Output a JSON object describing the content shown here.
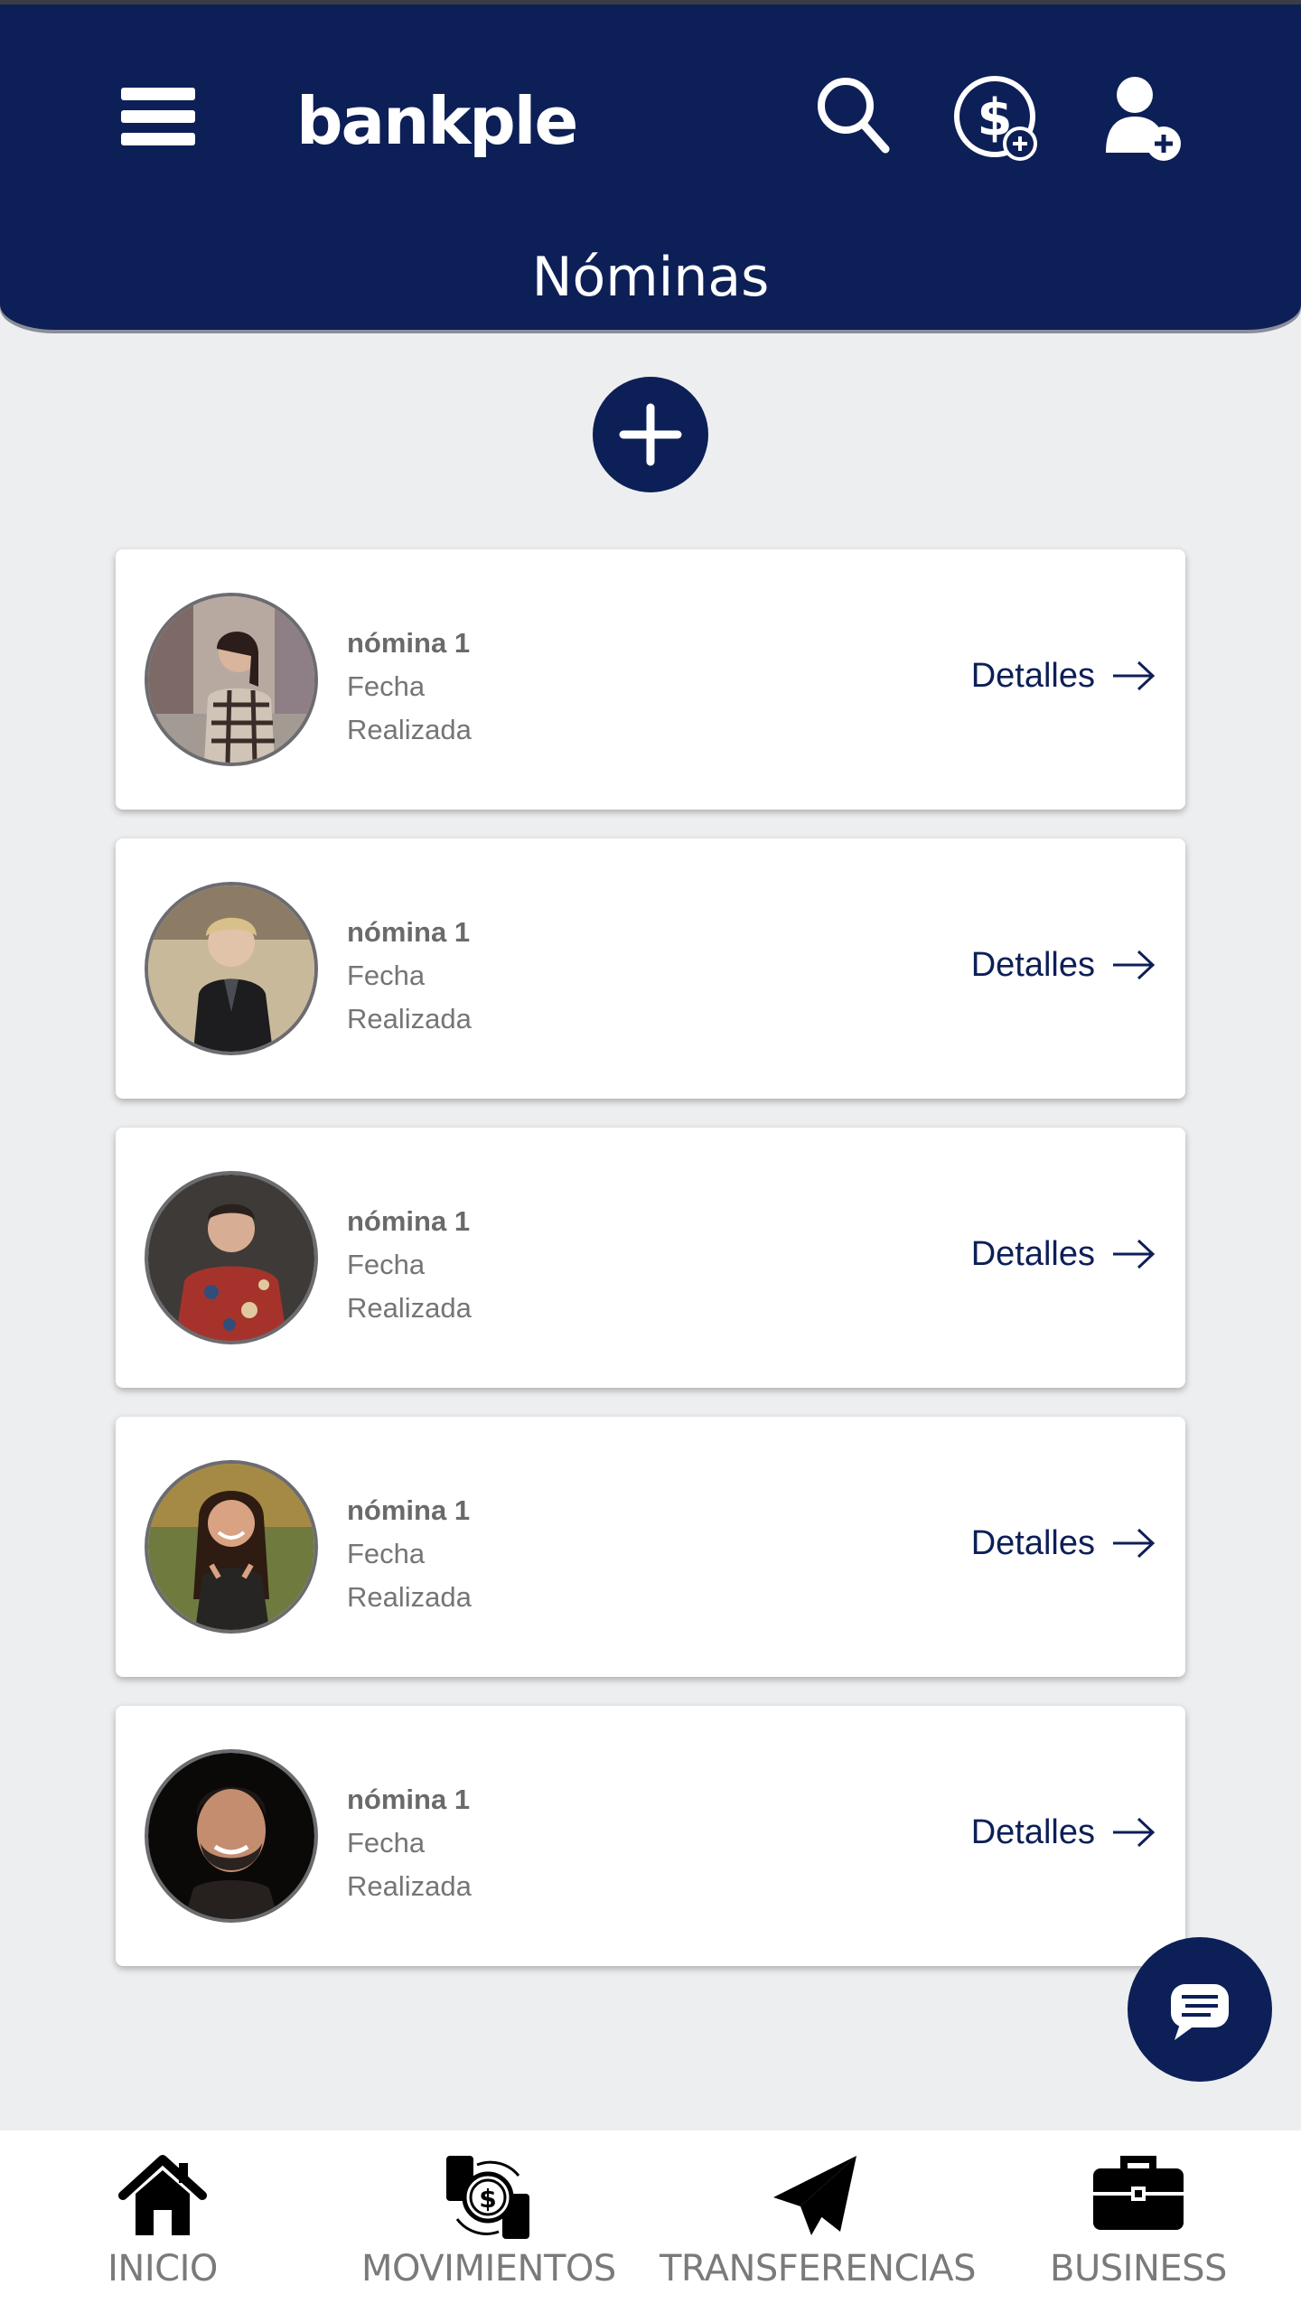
{
  "app": {
    "logo_text": "bankple",
    "page_title": "Nóminas"
  },
  "header": {
    "icons": [
      "menu-icon",
      "search-icon",
      "dollar-add-icon",
      "user-add-icon"
    ]
  },
  "payrolls": [
    {
      "title": "nómina 1",
      "date": "Fecha",
      "status": "Realizada",
      "details_label": "Detalles"
    },
    {
      "title": "nómina 1",
      "date": "Fecha",
      "status": "Realizada",
      "details_label": "Detalles"
    },
    {
      "title": "nómina 1",
      "date": "Fecha",
      "status": "Realizada",
      "details_label": "Detalles"
    },
    {
      "title": "nómina 1",
      "date": "Fecha",
      "status": "Realizada",
      "details_label": "Detalles"
    },
    {
      "title": "nómina 1",
      "date": "Fecha",
      "status": "Realizada",
      "details_label": "Detalles"
    }
  ],
  "bottom_nav": [
    {
      "label": "INICIO",
      "icon": "home-icon"
    },
    {
      "label": "MOVIMIENTOS",
      "icon": "money-exchange-icon"
    },
    {
      "label": "TRANSFERENCIAS",
      "icon": "paper-plane-icon"
    },
    {
      "label": "BUSINESS",
      "icon": "briefcase-icon"
    }
  ],
  "colors": {
    "primary": "#0d1f57",
    "background": "#edeef0",
    "card": "#ffffff",
    "muted_text": "#757575"
  }
}
